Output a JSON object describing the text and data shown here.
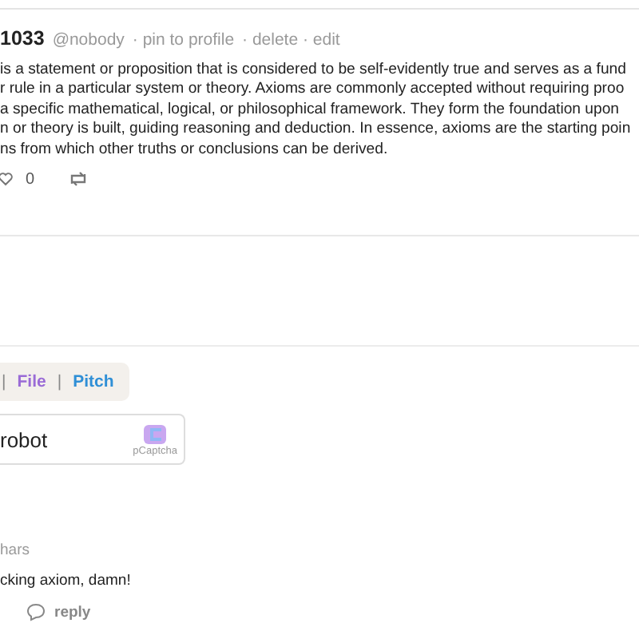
{
  "post": {
    "id": "1033",
    "handle": "@nobody",
    "actions": [
      "· pin to profile",
      "· delete · edit"
    ],
    "body_lines": [
      "is a statement or proposition that is considered to be self-evidently true and serves as a fund",
      "r rule in a particular system or theory. Axioms are commonly accepted without requiring proo",
      "a specific mathematical, logical, or philosophical framework. They form the foundation upon",
      "n or theory is built, guiding reasoning and deduction. In essence, axioms are the starting poin",
      "ns from which other truths or conclusions can be derived."
    ],
    "likes": "0"
  },
  "toolbar": {
    "separator": "|",
    "links": [
      {
        "label": "File",
        "color": "#9a6bd6"
      },
      {
        "label": "Pitch",
        "color": "#2f8fd6"
      }
    ]
  },
  "captcha": {
    "label": "robot",
    "brand": "pCaptcha"
  },
  "comment": {
    "meta": "hars",
    "text": "cking axiom, damn!",
    "reply": "reply"
  }
}
